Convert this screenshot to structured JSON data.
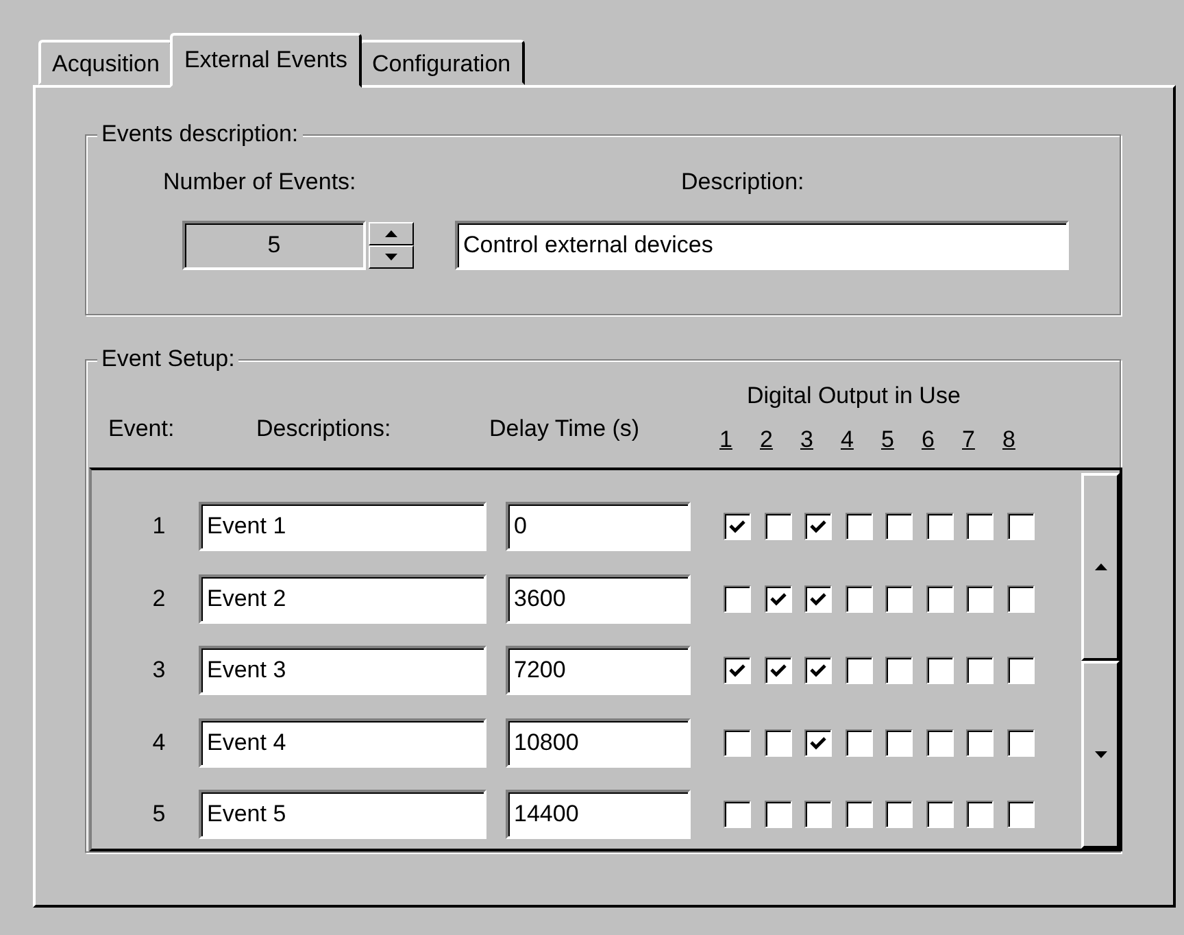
{
  "tabs": [
    {
      "label": "Acqusition",
      "selected": false
    },
    {
      "label": "External Events",
      "selected": true
    },
    {
      "label": "Configuration",
      "selected": false
    }
  ],
  "events_description": {
    "title": "Events description:",
    "number_label": "Number of Events:",
    "number_value": "5",
    "number_disabled": true,
    "description_label": "Description:",
    "description_value": "Control external devices"
  },
  "event_setup": {
    "title": "Event Setup:",
    "columns": {
      "event": "Event:",
      "descriptions": "Descriptions:",
      "delay": "Delay Time (s)",
      "outputs": "Digital Output in Use"
    },
    "output_numbers": [
      "1",
      "2",
      "3",
      "4",
      "5",
      "6",
      "7",
      "8"
    ],
    "rows": [
      {
        "number": "1",
        "description": "Event 1",
        "delay": "0",
        "outputs": [
          true,
          false,
          true,
          false,
          false,
          false,
          false,
          false
        ]
      },
      {
        "number": "2",
        "description": "Event 2",
        "delay": "3600",
        "outputs": [
          false,
          true,
          true,
          false,
          false,
          false,
          false,
          false
        ]
      },
      {
        "number": "3",
        "description": "Event 3",
        "delay": "7200",
        "outputs": [
          true,
          true,
          true,
          false,
          false,
          false,
          false,
          false
        ]
      },
      {
        "number": "4",
        "description": "Event 4",
        "delay": "10800",
        "outputs": [
          false,
          false,
          true,
          false,
          false,
          false,
          false,
          false
        ]
      },
      {
        "number": "5",
        "description": "Event 5",
        "delay": "14400",
        "outputs": [
          false,
          false,
          false,
          false,
          false,
          false,
          false,
          false
        ]
      }
    ]
  }
}
